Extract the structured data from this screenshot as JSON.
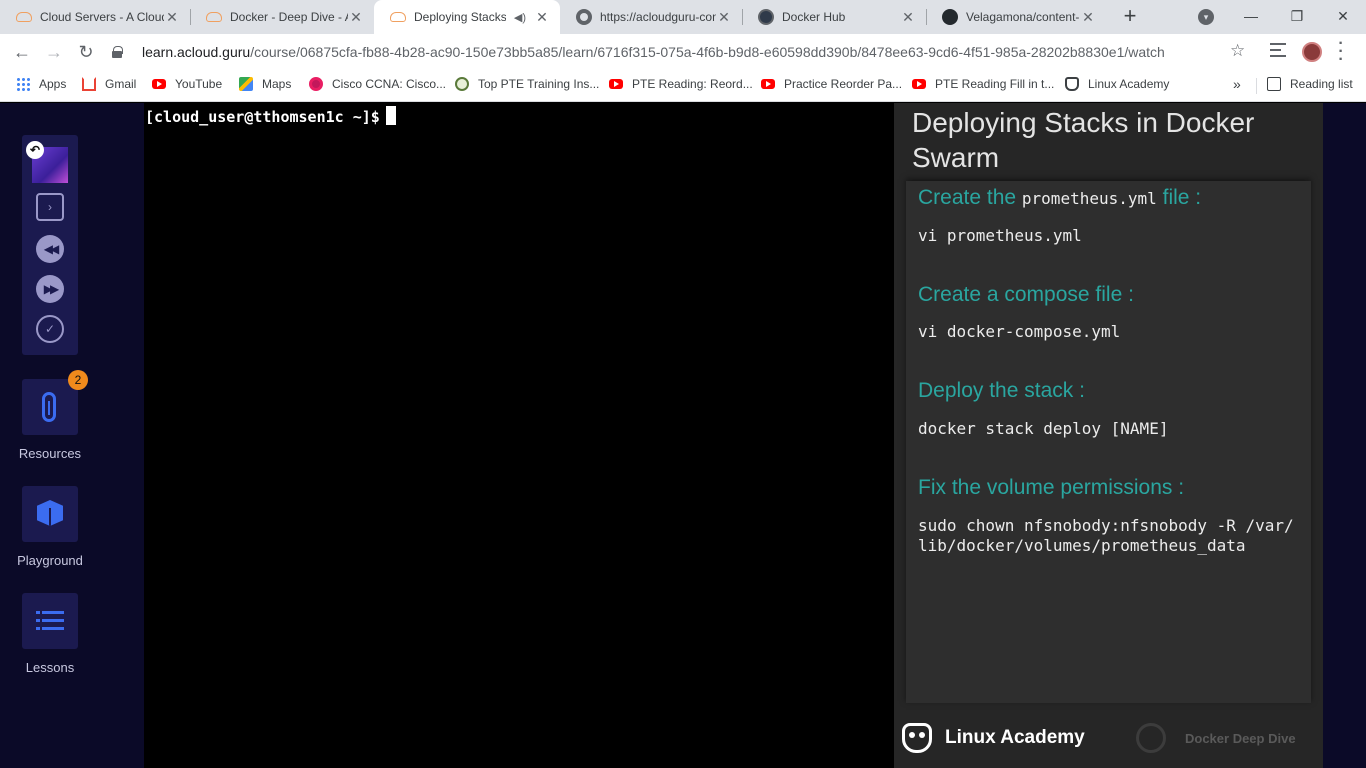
{
  "browser": {
    "tabs": [
      {
        "title": "Cloud Servers - A Cloud Guru",
        "favicon": "cloud-icon"
      },
      {
        "title": "Docker - Deep Dive - A Cloud Guru",
        "favicon": "cloud-icon"
      },
      {
        "title": "Deploying Stacks in Docker Swarm",
        "favicon": "cloud-icon",
        "active": true,
        "audio": true
      },
      {
        "title": "https://acloudguru-content",
        "favicon": "globe-icon"
      },
      {
        "title": "Docker Hub",
        "favicon": "docker-icon"
      },
      {
        "title": "Velagamona/content-",
        "favicon": "github-icon"
      }
    ],
    "new_tab": "+",
    "url_host": "learn.acloud.guru",
    "url_path": "/course/06875cfa-fb88-4b28-ac90-150e73bb5a85/learn/6716f315-075a-4f6b-b9d8-e60598dd390b/8478ee63-9cd6-4f51-985a-28202b8830e1/watch"
  },
  "bookmarks": [
    {
      "label": "Apps",
      "icon": "apps-icon"
    },
    {
      "label": "Gmail",
      "icon": "gmail-icon"
    },
    {
      "label": "YouTube",
      "icon": "youtube-icon"
    },
    {
      "label": "Maps",
      "icon": "maps-icon"
    },
    {
      "label": "Cisco CCNA: Cisco...",
      "icon": "cisco-icon"
    },
    {
      "label": "Top PTE Training Ins...",
      "icon": "pte-icon"
    },
    {
      "label": "PTE Reading: Reord...",
      "icon": "youtube-icon"
    },
    {
      "label": "Practice Reorder Pa...",
      "icon": "youtube-icon"
    },
    {
      "label": "PTE Reading Fill in t...",
      "icon": "youtube-icon"
    },
    {
      "label": "Linux Academy",
      "icon": "linux-academy-icon"
    }
  ],
  "bookmarks_more": "»",
  "reading_list": "Reading list",
  "sidebar": {
    "resources_label": "Resources",
    "resources_badge": "2",
    "playground_label": "Playground",
    "lessons_label": "Lessons"
  },
  "terminal": {
    "prompt": "[cloud_user@tthomsen1c ~]$"
  },
  "slide": {
    "title": "Deploying Stacks in Docker Swarm",
    "steps": [
      {
        "heading": "Create the",
        "heading_code": "prometheus.yml",
        "heading_tail": "file :",
        "command": "vi prometheus.yml"
      },
      {
        "heading": "Create a compose file :",
        "command": "vi docker-compose.yml"
      },
      {
        "heading": "Deploy the stack :",
        "command": "docker stack deploy [NAME]"
      },
      {
        "heading": "Fix the volume permissions :",
        "command": "sudo chown nfsnobody:nfsnobody -R /var/lib/docker/volumes/prometheus_data"
      }
    ],
    "footer_brand": "Linux Academy",
    "footer_course": "Docker Deep Dive"
  },
  "colors": {
    "accent_teal": "#2aa6a0",
    "sidebar_bg": "#0b0a28",
    "sidebar_button": "#1b1a4f",
    "icon_blue": "#3b6cf0",
    "badge_orange": "#f08a1c"
  }
}
